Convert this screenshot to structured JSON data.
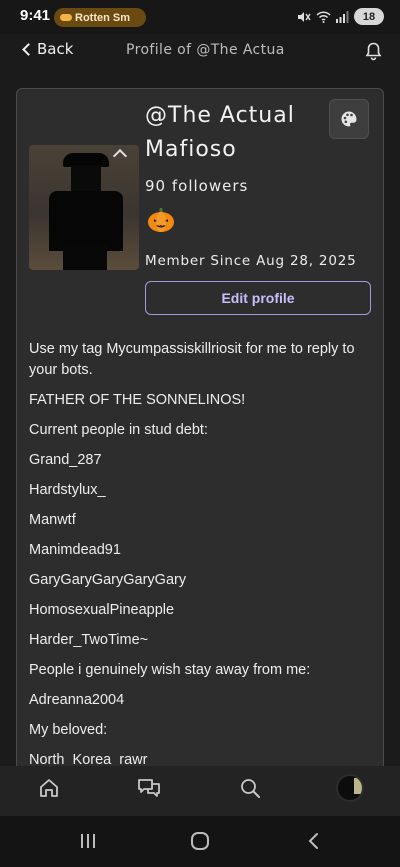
{
  "status_bar": {
    "time": "9:41",
    "notification_pill": "Rotten Sm",
    "battery": "18"
  },
  "header": {
    "back_label": "Back",
    "title": "Profile of @The Actual…"
  },
  "profile": {
    "name": "@The Actual Mafioso",
    "followers": "90 followers",
    "badge_icon": "pumpkin-icon",
    "member_since": "Member Since Aug 28, 2025",
    "edit_button": "Edit profile"
  },
  "bio": [
    "Use my tag Mycumpassiskillriosit for me to reply to your bots.",
    "FATHER OF THE SONNELINOS!",
    "Current people in stud debt:",
    "Grand_287",
    "Hardstylux_",
    "Manwtf",
    "Manimdead91",
    "GaryGaryGaryGaryGary",
    "HomosexualPineapple",
    "Harder_TwoTime~",
    "People i genuinely wish stay away from me:",
    "Adreanna2004",
    "My beloved:",
    "North_Korea_rawr"
  ],
  "tabbar": {
    "items": [
      "home-icon",
      "chat-icon",
      "search-icon",
      "profile-avatar"
    ]
  },
  "colors": {
    "accent": "#c9bdfa",
    "card_bg": "#2d2d2d",
    "page_bg": "#1b1b1b"
  }
}
